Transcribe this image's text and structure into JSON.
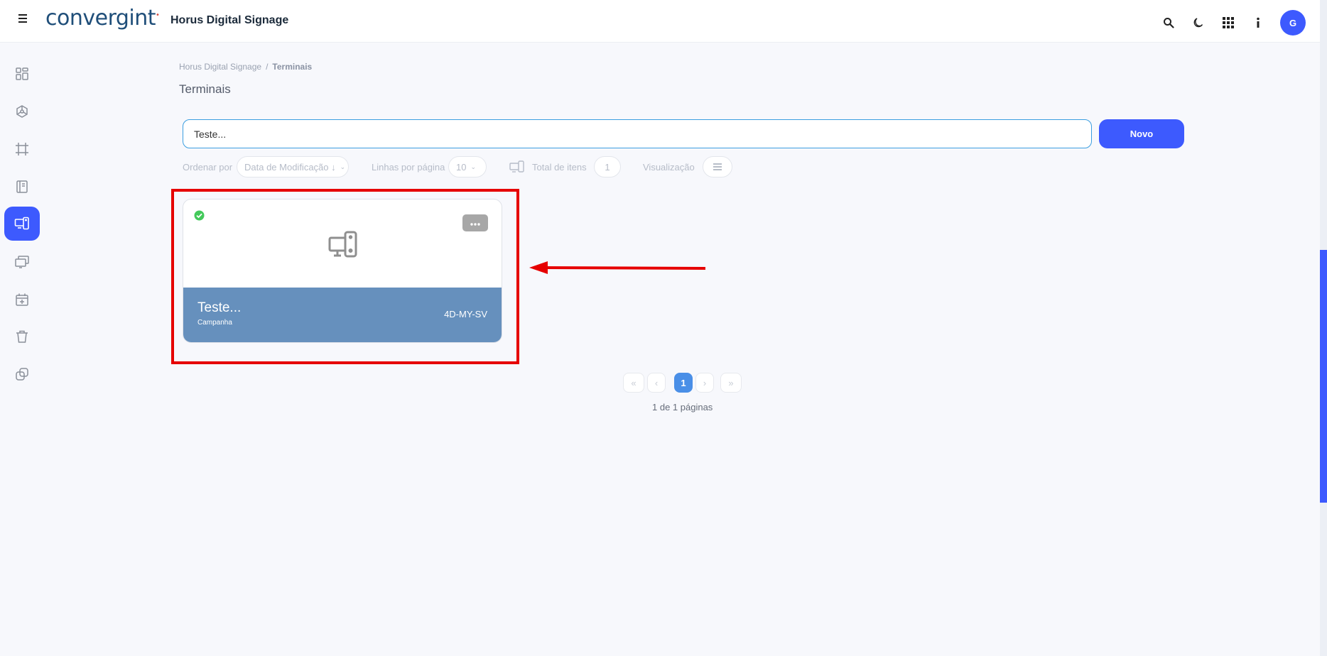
{
  "header": {
    "logo_text": "convergint",
    "app_title": "Horus Digital Signage",
    "avatar_initial": "G",
    "icons": [
      "menu-icon",
      "search-icon",
      "moon-icon",
      "apps-grid-icon",
      "info-icon"
    ]
  },
  "sidebar": {
    "items": [
      {
        "icon": "dashboard-icon"
      },
      {
        "icon": "hexagon-network-icon"
      },
      {
        "icon": "crop-frame-icon"
      },
      {
        "icon": "notebook-icon"
      },
      {
        "icon": "terminal-devices-icon",
        "active": true
      },
      {
        "icon": "monitors-icon"
      },
      {
        "icon": "calendar-plus-icon"
      },
      {
        "icon": "trash-icon"
      },
      {
        "icon": "link-icon"
      }
    ]
  },
  "breadcrumb": {
    "root": "Horus Digital Signage",
    "separator": "/",
    "current": "Terminais"
  },
  "page": {
    "title": "Terminais"
  },
  "search": {
    "value": "Teste..."
  },
  "toolbar": {
    "new_label": "Novo"
  },
  "filters": {
    "order_label": "Ordenar por",
    "order_value": "Data de Modificação ↓",
    "rows_label": "Linhas por página",
    "rows_value": "10",
    "total_label": "Total de itens",
    "total_value": "1",
    "view_label": "Visualização"
  },
  "cards": [
    {
      "name": "Teste...",
      "subtitle": "Campanha",
      "code": "4D-MY-SV",
      "status": "online"
    }
  ],
  "pagination": {
    "current_page": "1",
    "info": "1 de 1 páginas"
  },
  "colors": {
    "accent": "#3d5afe",
    "card_footer": "#6690bd",
    "status_ok": "#43c95a",
    "annotation": "#e60000"
  }
}
